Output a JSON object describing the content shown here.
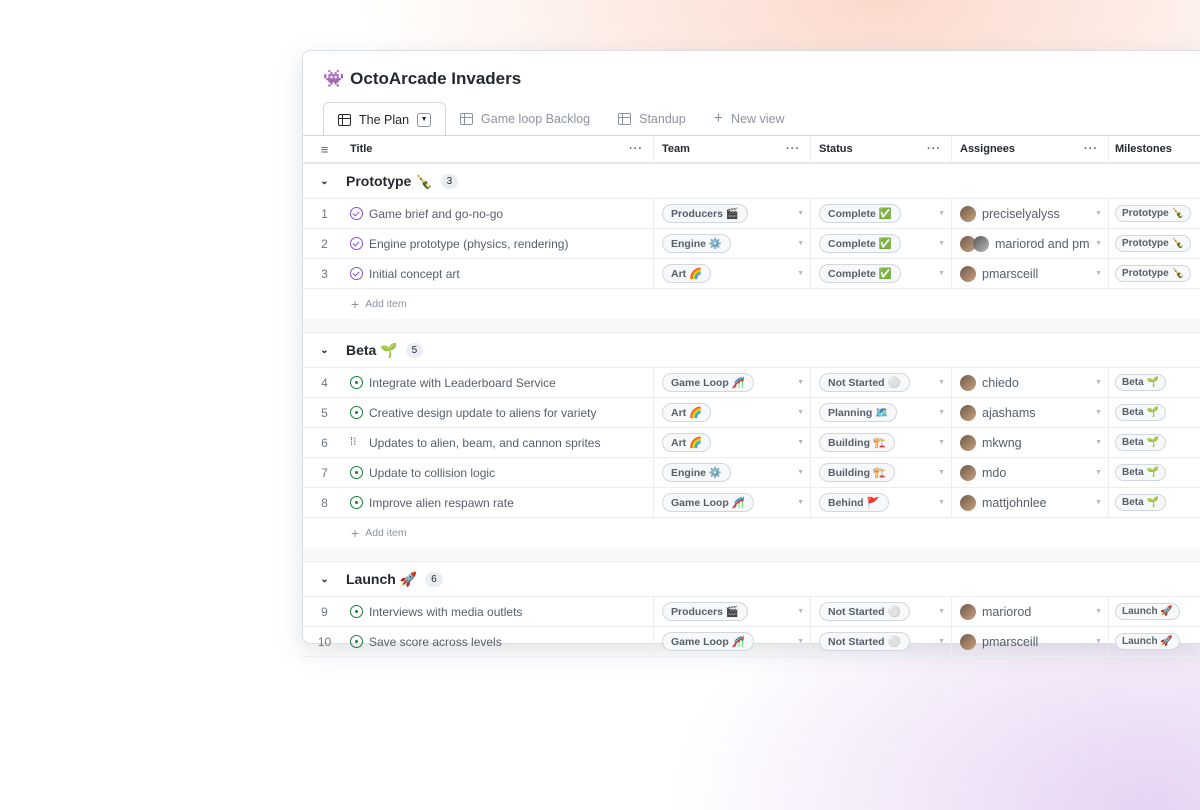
{
  "project": {
    "icon": "👾",
    "title": "OctoArcade Invaders"
  },
  "tabs": [
    {
      "label": "The Plan",
      "active": true
    },
    {
      "label": "Game loop Backlog"
    },
    {
      "label": "Standup"
    },
    {
      "label": "New view"
    }
  ],
  "columns": [
    "Title",
    "Team",
    "Status",
    "Assignees",
    "Milestones"
  ],
  "add_item": "Add item",
  "groups": [
    {
      "name": "Prototype 🍾",
      "count": "3",
      "items": [
        {
          "n": "1",
          "state": "done",
          "title": "Game brief and go-no-go",
          "team": "Producers 🎬",
          "status": "Complete ✅",
          "assignee": "preciselyalyss",
          "avatars": 1,
          "milestone": "Prototype 🍾"
        },
        {
          "n": "2",
          "state": "done",
          "title": "Engine prototype (physics, rendering)",
          "team": "Engine ⚙️",
          "status": "Complete ✅",
          "assignee": "mariorod and pm",
          "avatars": 2,
          "milestone": "Prototype 🍾"
        },
        {
          "n": "3",
          "state": "done",
          "title": "Initial concept art",
          "team": "Art 🌈",
          "status": "Complete ✅",
          "assignee": "pmarsceill",
          "avatars": 1,
          "milestone": "Prototype 🍾"
        }
      ]
    },
    {
      "name": "Beta 🌱",
      "count": "5",
      "items": [
        {
          "n": "4",
          "state": "open",
          "title": "Integrate with Leaderboard Service",
          "team": "Game Loop 🎢",
          "status": "Not Started ⚪",
          "assignee": "chiedo",
          "avatars": 1,
          "milestone": "Beta 🌱"
        },
        {
          "n": "5",
          "state": "open",
          "title": "Creative design update to aliens for variety",
          "team": "Art 🌈",
          "status": "Planning 🗺️",
          "assignee": "ajashams",
          "avatars": 1,
          "milestone": "Beta 🌱"
        },
        {
          "n": "6",
          "state": "pr",
          "title": "Updates to alien, beam, and cannon sprites",
          "team": "Art 🌈",
          "status": "Building 🏗️",
          "assignee": "mkwng",
          "avatars": 1,
          "milestone": "Beta 🌱"
        },
        {
          "n": "7",
          "state": "open",
          "title": "Update to collision logic",
          "team": "Engine ⚙️",
          "status": "Building 🏗️",
          "assignee": "mdo",
          "avatars": 1,
          "milestone": "Beta 🌱"
        },
        {
          "n": "8",
          "state": "open",
          "title": "Improve alien respawn rate",
          "team": "Game Loop 🎢",
          "status": "Behind 🚩",
          "assignee": "mattjohnlee",
          "avatars": 1,
          "milestone": "Beta 🌱"
        }
      ]
    },
    {
      "name": "Launch 🚀",
      "count": "6",
      "items": [
        {
          "n": "9",
          "state": "open",
          "title": "Interviews with media outlets",
          "team": "Producers 🎬",
          "status": "Not Started ⚪",
          "assignee": "mariorod",
          "avatars": 1,
          "milestone": "Launch 🚀"
        },
        {
          "n": "10",
          "state": "open",
          "title": "Save score across levels",
          "team": "Game Loop 🎢",
          "status": "Not Started ⚪",
          "assignee": "pmarsceill",
          "avatars": 1,
          "milestone": "Launch 🚀"
        }
      ]
    }
  ]
}
